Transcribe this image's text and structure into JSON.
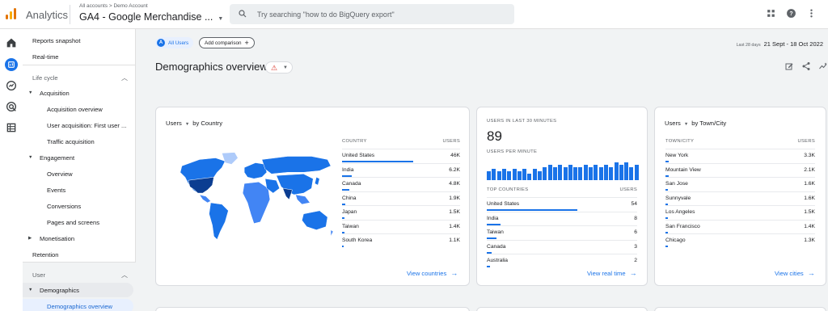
{
  "header": {
    "app_name": "Analytics",
    "breadcrumb": "All accounts > Demo Account",
    "property": "GA4 - Google Merchandise ...",
    "search_placeholder": "Try searching \"how to do BigQuery export\"",
    "icons": [
      "apps-grid-icon",
      "help-icon",
      "more-vert-icon"
    ]
  },
  "rail": {
    "icons": [
      "home-icon",
      "reports-icon",
      "explore-icon",
      "advertising-icon",
      "configure-icon"
    ]
  },
  "nav": {
    "reports_snapshot": "Reports snapshot",
    "realtime": "Real-time",
    "life_cycle": "Life cycle",
    "acquisition": "Acquisition",
    "acquisition_overview": "Acquisition overview",
    "user_acquisition": "User acquisition: First user ...",
    "traffic_acquisition": "Traffic acquisition",
    "engagement": "Engagement",
    "overview": "Overview",
    "events": "Events",
    "conversions": "Conversions",
    "pages_and_screens": "Pages and screens",
    "monetisation": "Monetisation",
    "retention": "Retention",
    "user": "User",
    "demographics": "Demographics",
    "demographics_overview": "Demographics overview"
  },
  "toolbar": {
    "all_users_avatar": "A",
    "all_users": "All Users",
    "add_comparison": "Add comparison",
    "date_prefix": "Last 28 days",
    "date_range": "21 Sept - 18 Oct 2022"
  },
  "page": {
    "title": "Demographics overview"
  },
  "countries_card": {
    "title_metric": "Users",
    "title_dim": "by Country",
    "col_dim": "COUNTRY",
    "col_metric": "USERS",
    "rows": [
      {
        "name": "United States",
        "value": "46K",
        "frac": 1.0
      },
      {
        "name": "India",
        "value": "6.2K",
        "frac": 0.135
      },
      {
        "name": "Canada",
        "value": "4.8K",
        "frac": 0.104
      },
      {
        "name": "China",
        "value": "1.9K",
        "frac": 0.041
      },
      {
        "name": "Japan",
        "value": "1.5K",
        "frac": 0.033
      },
      {
        "name": "Taiwan",
        "value": "1.4K",
        "frac": 0.03
      },
      {
        "name": "South Korea",
        "value": "1.1K",
        "frac": 0.024
      }
    ],
    "link": "View countries"
  },
  "realtime_card": {
    "label": "USERS IN LAST 30 MINUTES",
    "value": "89",
    "per_minute_label": "USERS PER MINUTE",
    "per_minute": [
      4,
      5,
      4,
      5,
      4,
      5,
      4,
      5,
      3,
      5,
      4,
      6,
      7,
      6,
      7,
      6,
      7,
      6,
      6,
      7,
      6,
      7,
      6,
      7,
      6,
      8,
      7,
      8,
      6,
      7
    ],
    "col_dim": "TOP COUNTRIES",
    "col_metric": "USERS",
    "rows": [
      {
        "name": "United States",
        "value": "54",
        "frac": 1.0
      },
      {
        "name": "India",
        "value": "8",
        "frac": 0.148
      },
      {
        "name": "Taiwan",
        "value": "6",
        "frac": 0.111
      },
      {
        "name": "Canada",
        "value": "3",
        "frac": 0.056
      },
      {
        "name": "Australia",
        "value": "2",
        "frac": 0.037
      }
    ],
    "link": "View real time"
  },
  "cities_card": {
    "title_metric": "Users",
    "title_dim": "by Town/City",
    "col_dim": "TOWN/CITY",
    "col_metric": "USERS",
    "rows": [
      {
        "name": "New York",
        "value": "3.3K",
        "frac": 0.04
      },
      {
        "name": "Mountain View",
        "value": "2.1K",
        "frac": 0.035
      },
      {
        "name": "San Jose",
        "value": "1.6K",
        "frac": 0.03
      },
      {
        "name": "Sunnyvale",
        "value": "1.6K",
        "frac": 0.03
      },
      {
        "name": "Los Angeles",
        "value": "1.5K",
        "frac": 0.03
      },
      {
        "name": "San Francisco",
        "value": "1.4K",
        "frac": 0.028
      },
      {
        "name": "Chicago",
        "value": "1.3K",
        "frac": 0.026
      }
    ],
    "link": "View cities"
  },
  "colors": {
    "accent": "#1a73e8",
    "map_dark": "#1557b0",
    "map_light": "#aecbfa",
    "warning": "#d93025"
  }
}
